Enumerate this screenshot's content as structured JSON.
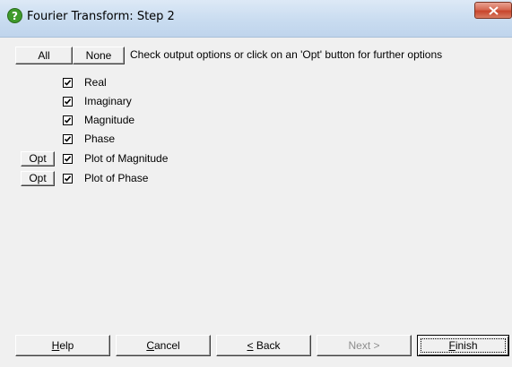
{
  "window": {
    "title": "Fourier Transform: Step 2",
    "close_symbol": "✕",
    "icon": "help-question-icon"
  },
  "toolbar": {
    "all_label": "All",
    "none_label": "None",
    "hint": "Check output options or click on an 'Opt' button for further options"
  },
  "options": [
    {
      "label": "Real",
      "checked": true,
      "has_opt": false
    },
    {
      "label": "Imaginary",
      "checked": true,
      "has_opt": false
    },
    {
      "label": "Magnitude",
      "checked": true,
      "has_opt": false
    },
    {
      "label": "Phase",
      "checked": true,
      "has_opt": false
    },
    {
      "label": "Plot of Magnitude",
      "checked": true,
      "has_opt": true,
      "opt_label": "Opt"
    },
    {
      "label": "Plot of Phase",
      "checked": true,
      "has_opt": true,
      "opt_label": "Opt"
    }
  ],
  "buttons": {
    "help": {
      "prefix": "",
      "mnemonic": "H",
      "rest": "elp"
    },
    "cancel": {
      "prefix": "",
      "mnemonic": "C",
      "rest": "ancel"
    },
    "back": {
      "prefix": "",
      "mnemonic": "<",
      "rest": " Back"
    },
    "next": {
      "label": "Next >",
      "enabled": false
    },
    "finish": {
      "prefix": "",
      "mnemonic": "F",
      "rest": "inish"
    }
  },
  "colors": {
    "titlebar": "#c9dcf0",
    "close": "#c8452c",
    "dialog_bg": "#f0f0f0",
    "help_icon": "#4a9a2a"
  }
}
